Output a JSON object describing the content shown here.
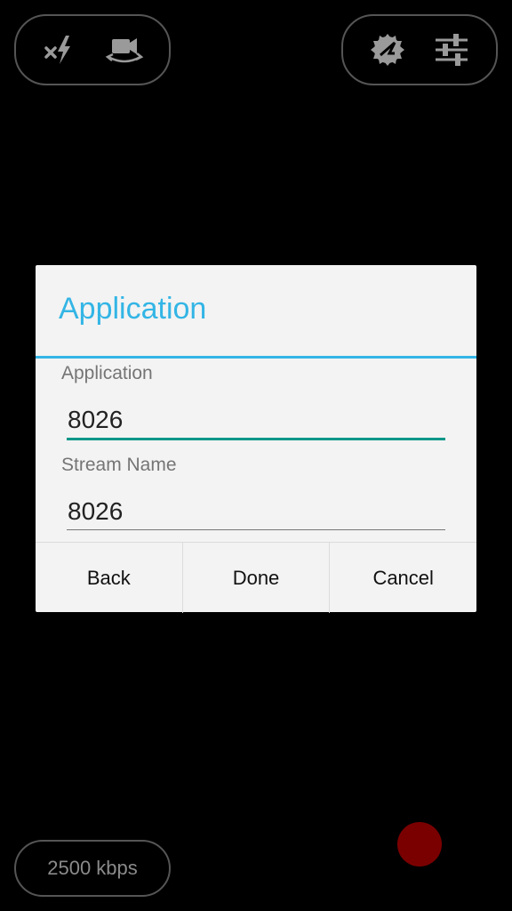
{
  "toolbar": {
    "left_icons": [
      "flash-off-icon",
      "switch-camera-icon"
    ],
    "right_icons": [
      "broadcast-icon",
      "settings-sliders-icon"
    ]
  },
  "dialog": {
    "title": "Application",
    "fields": [
      {
        "label": "Application",
        "value": "8026"
      },
      {
        "label": "Stream Name",
        "value": "8026"
      }
    ],
    "buttons": {
      "back": "Back",
      "done": "Done",
      "cancel": "Cancel"
    }
  },
  "status": {
    "bitrate": "2500 kbps"
  },
  "colors": {
    "accent": "#33b5e5",
    "focus_underline": "#009688",
    "record": "#7a0000",
    "icon": "#9a9a9a"
  }
}
